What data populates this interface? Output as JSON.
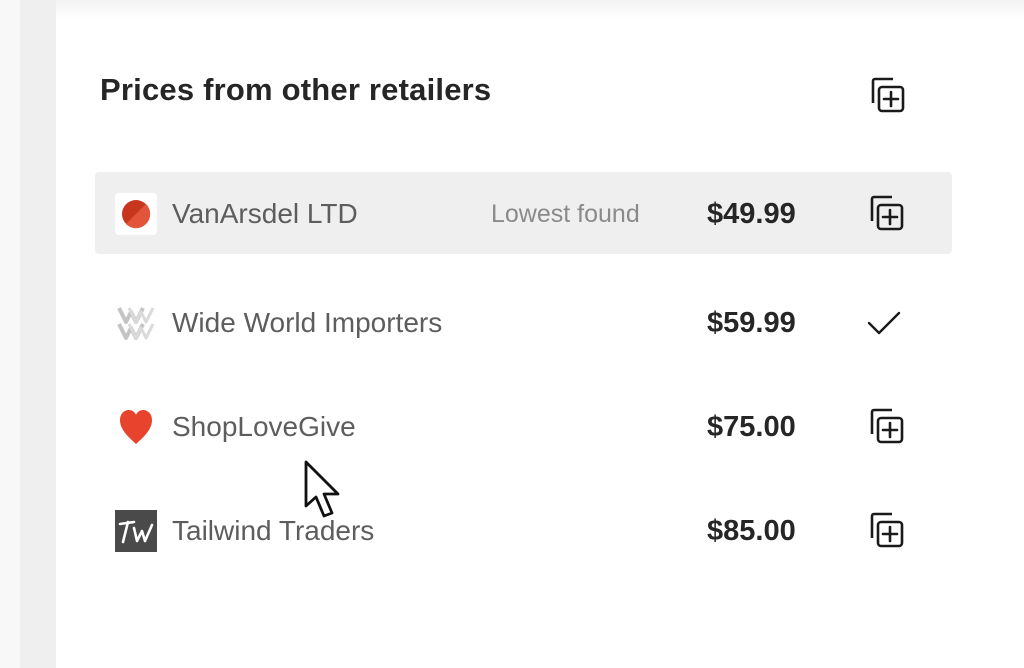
{
  "panel": {
    "title": "Prices from other retailers"
  },
  "retailers": [
    {
      "name": "VanArsdel LTD",
      "tag": "Lowest found",
      "price": "$49.99",
      "action": "add-to-collection-icon",
      "logo": "vanarsdel-logo",
      "logo_color": "#d13b21"
    },
    {
      "name": "Wide World Importers",
      "tag": "",
      "price": "$59.99",
      "action": "checkmark-icon",
      "logo": "wide-world-importers-logo",
      "logo_color": "#bdbdbd"
    },
    {
      "name": "ShopLoveGive",
      "tag": "",
      "price": "$75.00",
      "action": "add-to-collection-icon",
      "logo": "heart-logo",
      "logo_color": "#e8432d"
    },
    {
      "name": "Tailwind Traders",
      "tag": "",
      "price": "$85.00",
      "action": "add-to-collection-icon",
      "logo": "tailwind-traders-logo",
      "logo_color": "#4a4a4a"
    }
  ],
  "colors": {
    "highlight_row": "#efefef",
    "text_primary": "#262626",
    "text_secondary": "#5d5d5d",
    "text_muted": "#8a8a8a"
  }
}
